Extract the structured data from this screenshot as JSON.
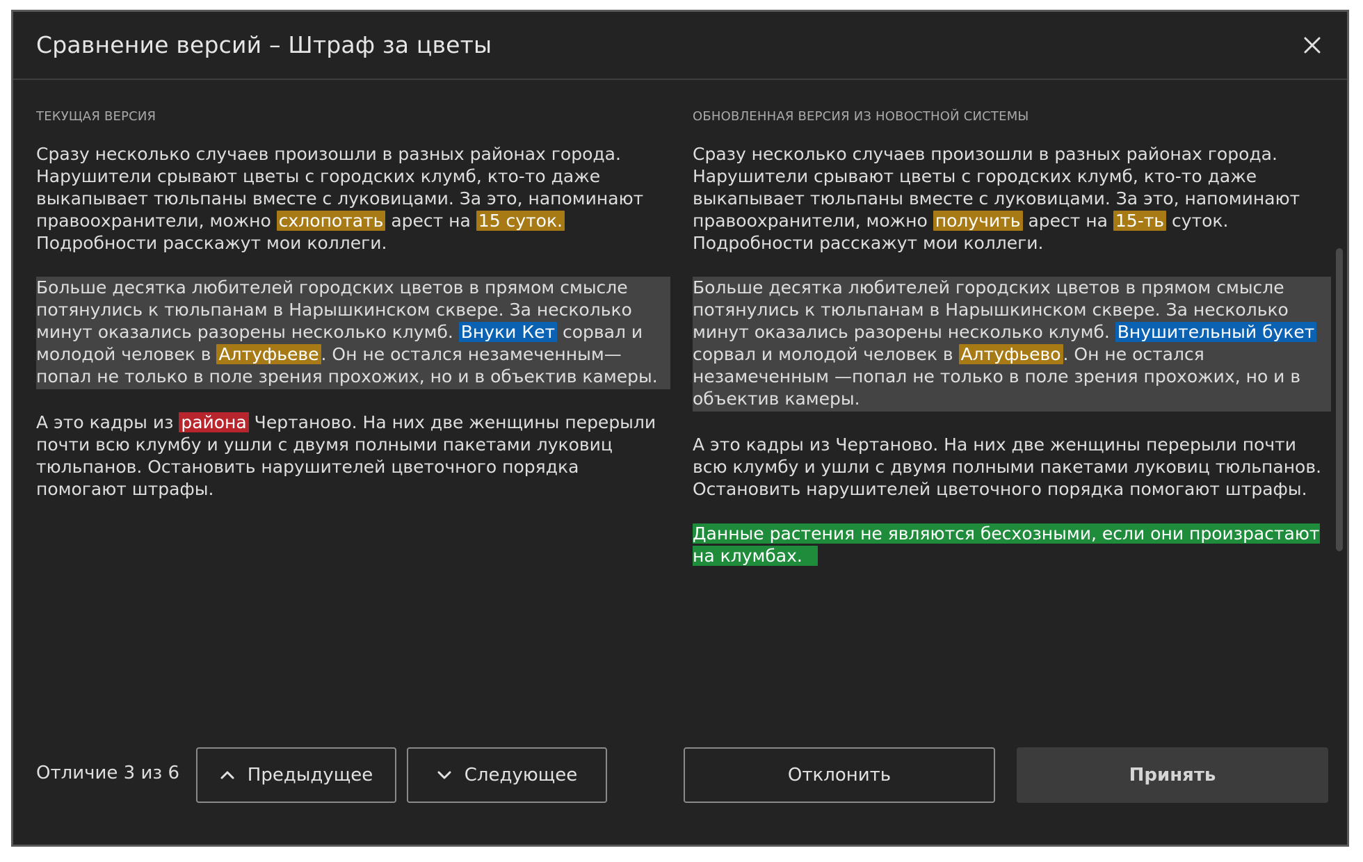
{
  "window": {
    "title": "Сравнение версий – Штраф за цветы"
  },
  "colors": {
    "background": "#232323",
    "changed": "#a87a16",
    "replaced": "#0b62b3",
    "removed": "#b8252c",
    "added": "#1f8c3c",
    "current_block": "#444444"
  },
  "left": {
    "heading": "ТЕКУЩАЯ ВЕРСИЯ",
    "p1": {
      "t1": "Сразу несколько случаев произошли в разных районах города. Нарушители срывают цветы с городских клумб, кто-то даже выкапывает тюльпаны вместе с луковицами. За это, напоминают правоохранители, можно ",
      "h1": "схлопотать",
      "t2": " арест на ",
      "h2": "15 суток.",
      "t3": " Подробности расскажут мои коллеги."
    },
    "p2": {
      "t1": "Больше десятка любителей городских цветов в прямом смысле потянулись к тюльпанам в Нарышкинском сквере. За несколько минут оказались разорены несколько клумб. ",
      "h1": "Внуки Кет",
      "t2": " сорвал и молодой человек в ",
      "h2": "Алтуфьеве",
      "t3": ". Он не остался незамеченным—попал не только в поле зрения прохожих, но и в объектив камеры."
    },
    "p3": {
      "t1": "А это кадры из ",
      "h1": "района",
      "t2": " Чертаново. На них две женщины перерыли почти всю клумбу и ушли с двумя полными пакетами луковиц тюльпанов. Остановить нарушителей цветочного порядка помогают штрафы."
    }
  },
  "right": {
    "heading": "ОБНОВЛЕННАЯ ВЕРСИЯ ИЗ НОВОСТНОЙ СИСТЕМЫ",
    "p1": {
      "t1": "Сразу несколько случаев произошли в разных районах города. Нарушители срывают цветы с городских клумб, кто-то даже выкапывает тюльпаны вместе с луковицами. За это, напоминают правоохранители, можно ",
      "h1": "получить",
      "t2": " арест на ",
      "h2": "15-ть",
      "t3": " суток. Подробности расскажут мои коллеги."
    },
    "p2": {
      "t1": "Больше десятка любителей городских цветов в прямом смысле потянулись к тюльпанам в Нарышкинском сквере. За несколько минут оказались разорены несколько клумб. ",
      "h1": "Внушительный букет",
      "t2": " сорвал и молодой человек в ",
      "h2": "Алтуфьево",
      "t3": ". Он не остался незамеченным —попал не только в поле зрения прохожих, но и в объектив камеры."
    },
    "p3": {
      "t1": "А это кадры из Чертаново. На них две женщины перерыли почти всю клумбу и ушли с двумя полными пакетами луковиц тюльпанов. Остановить нарушителей цветочного порядка помогают штрафы."
    },
    "p4": {
      "h1": "Данные растения не являются бесхозными, если они произрастают на клумбах."
    }
  },
  "footer": {
    "diff_counter": "Отличие 3 из 6",
    "prev_label": "Предыдущее",
    "next_label": "Следующее",
    "reject_label": "Отклонить",
    "accept_label": "Принять"
  },
  "icons": {
    "close": "close-icon",
    "prev": "chevron-up-icon",
    "next": "chevron-down-icon"
  }
}
